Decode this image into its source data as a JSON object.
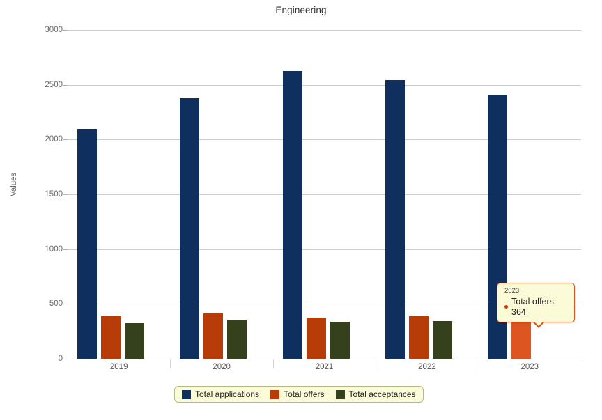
{
  "chart_data": {
    "type": "bar",
    "title": "Engineering",
    "xlabel": "",
    "ylabel": "Values",
    "categories": [
      "2019",
      "2020",
      "2021",
      "2022",
      "2023"
    ],
    "series": [
      {
        "name": "Total applications",
        "color": "#0f2f5e",
        "values": [
          2098,
          2376,
          2623,
          2543,
          2412
        ]
      },
      {
        "name": "Total offers",
        "color": "#b83c07",
        "values": [
          390,
          412,
          375,
          385,
          364
        ]
      },
      {
        "name": "Total acceptances",
        "color": "#35401c",
        "values": [
          325,
          355,
          338,
          345,
          null
        ]
      }
    ],
    "ylim": [
      0,
      3000
    ],
    "yticks": [
      0,
      500,
      1000,
      1500,
      2000,
      2500,
      3000
    ],
    "ytick_labels": [
      "0",
      "500",
      "1000",
      "1500",
      "2000",
      "2500",
      "3000"
    ],
    "grid": true,
    "legend_position": "bottom",
    "highlight": {
      "category": "2023",
      "series": "Total offers",
      "color": "#dd5520"
    }
  },
  "tooltip": {
    "title": "2023",
    "series_label": "Total offers",
    "value": "364",
    "text": "Total offers: 364",
    "dot_color": "#c3410a",
    "background": "#fbfbd7",
    "border_color": "#d8541f"
  },
  "legend": {
    "items": [
      {
        "label": "Total applications",
        "color": "#0f2f5e"
      },
      {
        "label": "Total offers",
        "color": "#b83c07"
      },
      {
        "label": "Total acceptances",
        "color": "#35401c"
      }
    ]
  }
}
